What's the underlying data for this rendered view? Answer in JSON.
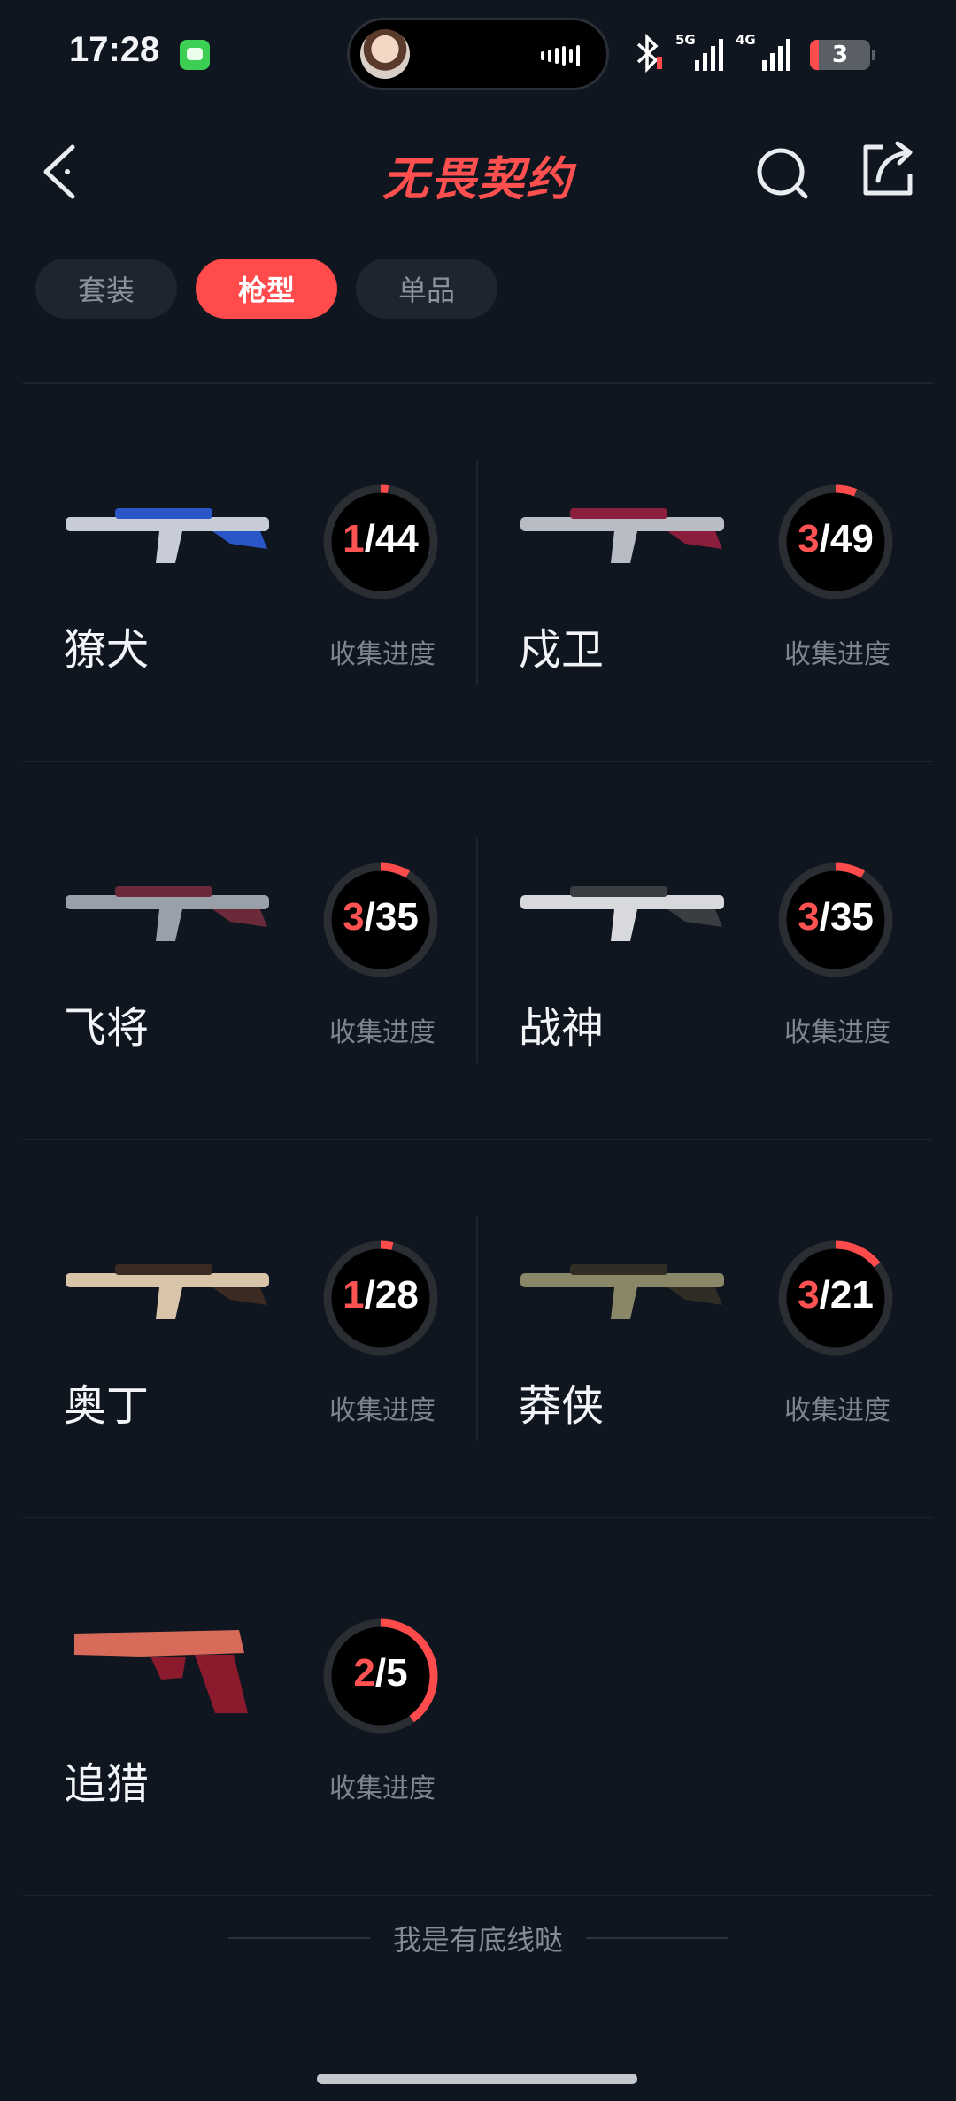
{
  "status_bar": {
    "time": "17:28",
    "network1": "5G",
    "network2": "4G",
    "battery": "3"
  },
  "header": {
    "title": "无畏契约"
  },
  "tabs": [
    {
      "label": "套装",
      "active": false
    },
    {
      "label": "枪型",
      "active": true
    },
    {
      "label": "单品",
      "active": false
    }
  ],
  "weapons": [
    {
      "name": "獠犬",
      "have": "1",
      "total": "/44",
      "progress": 0.0227,
      "progress_label": "收集进度",
      "skin_colors": [
        "#c8ccd6",
        "#2a56c8"
      ]
    },
    {
      "name": "戍卫",
      "have": "3",
      "total": "/49",
      "progress": 0.0612,
      "progress_label": "收集进度",
      "skin_colors": [
        "#b9bcc4",
        "#8a1e3c"
      ]
    },
    {
      "name": "飞将",
      "have": "3",
      "total": "/35",
      "progress": 0.0857,
      "progress_label": "收集进度",
      "skin_colors": [
        "#9aa0aa",
        "#6a2a3a"
      ]
    },
    {
      "name": "战神",
      "have": "3",
      "total": "/35",
      "progress": 0.0857,
      "progress_label": "收集进度",
      "skin_colors": [
        "#d7d9dc",
        "#3a3d42"
      ]
    },
    {
      "name": "奥丁",
      "have": "1",
      "total": "/28",
      "progress": 0.0357,
      "progress_label": "收集进度",
      "skin_colors": [
        "#d8c4a8",
        "#3a2a22"
      ]
    },
    {
      "name": "莽侠",
      "have": "3",
      "total": "/21",
      "progress": 0.1429,
      "progress_label": "收集进度",
      "skin_colors": [
        "#8a8668",
        "#2f2d24"
      ]
    },
    {
      "name": "追猎",
      "have": "2",
      "total": "/5",
      "progress": 0.4,
      "progress_label": "收集进度",
      "skin_colors": [
        "#d86a5a",
        "#8b1b2c"
      ]
    }
  ],
  "footer_text": "我是有底线哒",
  "colors": {
    "background": "#0f1620",
    "accent": "#ff4b4b",
    "ring_track": "#2a2d31"
  }
}
